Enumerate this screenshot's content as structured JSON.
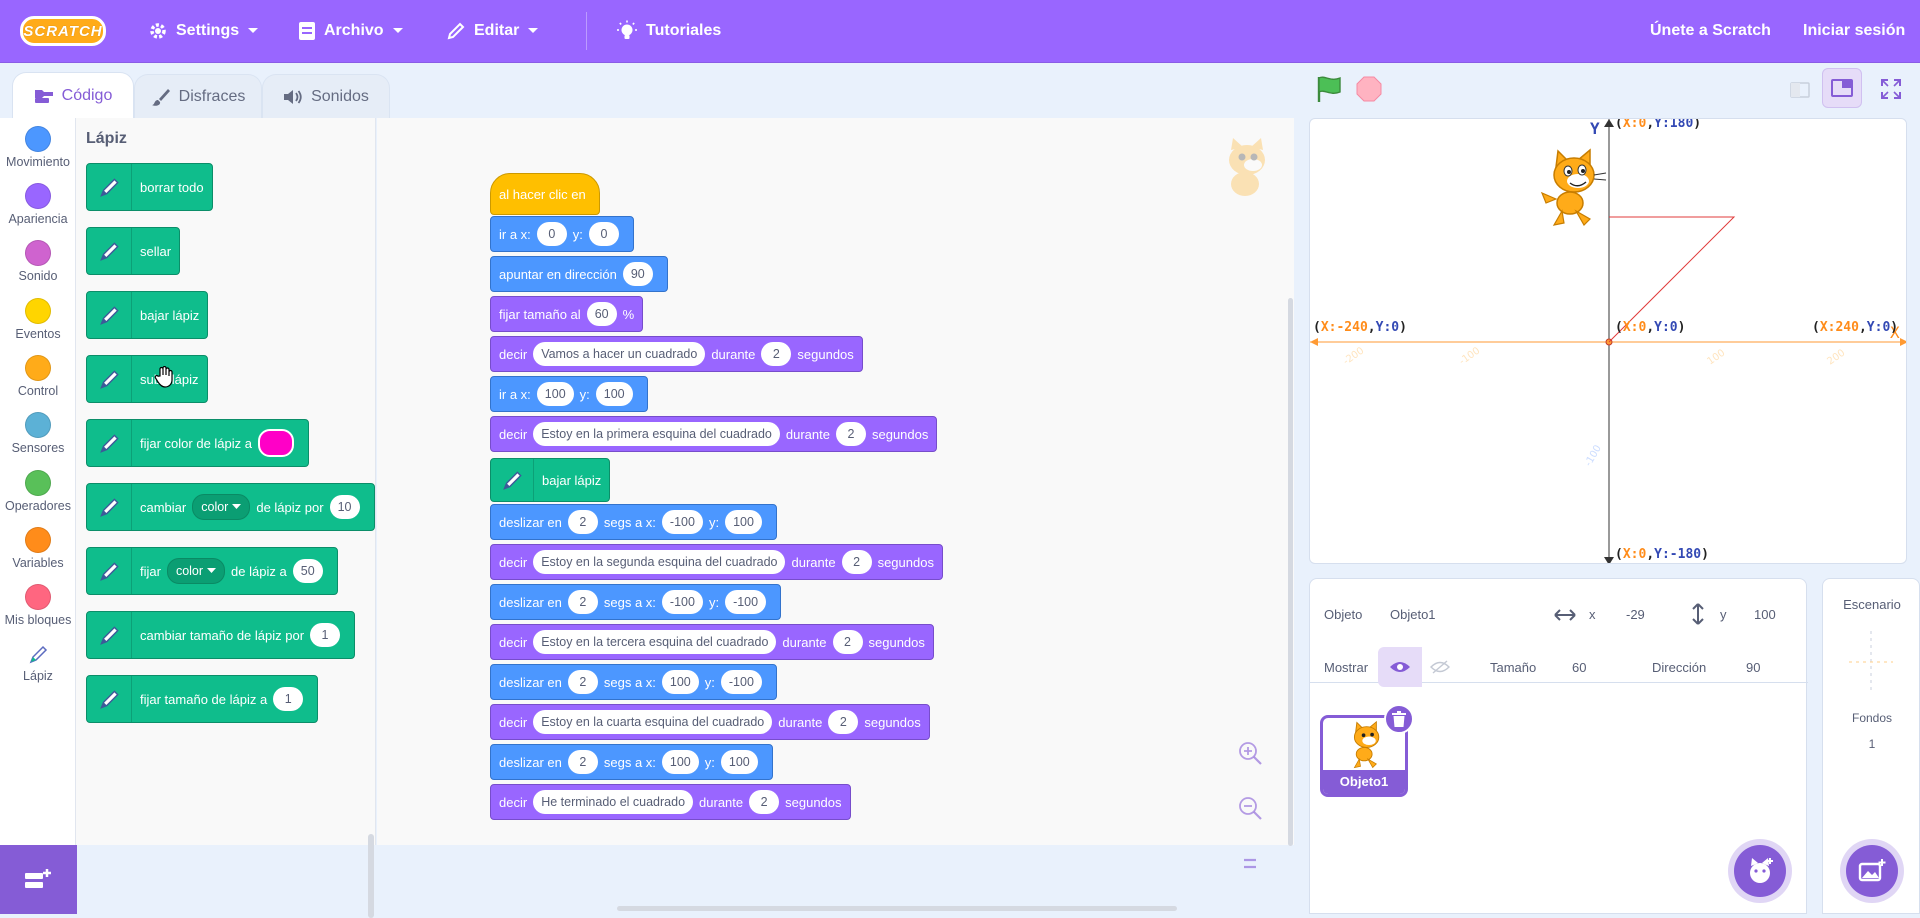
{
  "menubar": {
    "logo": "SCRATCH",
    "settings": "Settings",
    "file": "Archivo",
    "edit": "Editar",
    "tutorials": "Tutoriales",
    "join": "Únete a Scratch",
    "signin": "Iniciar sesión"
  },
  "tabs": {
    "code": "Código",
    "costumes": "Disfraces",
    "sounds": "Sonidos"
  },
  "categories": [
    {
      "label": "Movimiento",
      "color": "#4c97ff"
    },
    {
      "label": "Apariencia",
      "color": "#9966ff"
    },
    {
      "label": "Sonido",
      "color": "#cf63cf"
    },
    {
      "label": "Eventos",
      "color": "#ffd500"
    },
    {
      "label": "Control",
      "color": "#ffab19"
    },
    {
      "label": "Sensores",
      "color": "#5cb1d6"
    },
    {
      "label": "Operadores",
      "color": "#59c059"
    },
    {
      "label": "Variables",
      "color": "#ff8c1a"
    },
    {
      "label": "Mis bloques",
      "color": "#ff6680"
    },
    {
      "label": "Lápiz",
      "color": "#0fbd8c"
    }
  ],
  "palette": {
    "title": "Lápiz",
    "blocks": {
      "erase_all": "borrar todo",
      "stamp": "sellar",
      "pen_down": "bajar lápiz",
      "pen_up": "subir lápiz",
      "set_color_pre": "fijar color de lápiz a",
      "change_pre": "cambiar",
      "change_drop": "color",
      "change_mid": "de lápiz por",
      "change_val": "10",
      "set_pre": "fijar",
      "set_drop": "color",
      "set_mid": "de lápiz a",
      "set_val": "50",
      "change_size_pre": "cambiar tamaño de lápiz por",
      "change_size_val": "1",
      "set_size_pre": "fijar tamaño de lápiz a",
      "set_size_val": "1"
    }
  },
  "script": {
    "hat": "al hacer clic en",
    "goto1": {
      "pre": "ir a x:",
      "x": "0",
      "mid": "y:",
      "y": "0"
    },
    "point": {
      "pre": "apuntar en dirección",
      "val": "90"
    },
    "size": {
      "pre": "fijar tamaño al",
      "val": "60",
      "post": "%"
    },
    "say1": {
      "pre": "decir",
      "msg": "Vamos a hacer un cuadrado",
      "mid": "durante",
      "secs": "2",
      "post": "segundos"
    },
    "goto2": {
      "pre": "ir a x:",
      "x": "100",
      "mid": "y:",
      "y": "100"
    },
    "say2": {
      "pre": "decir",
      "msg": "Estoy en la primera esquina del cuadrado",
      "mid": "durante",
      "secs": "2",
      "post": "segundos"
    },
    "pendown": "bajar lápiz",
    "glide1": {
      "pre": "deslizar en",
      "secs": "2",
      "mid": "segs a x:",
      "x": "-100",
      "ylab": "y:",
      "y": "100"
    },
    "say3": {
      "pre": "decir",
      "msg": "Estoy en la segunda esquina del cuadrado",
      "mid": "durante",
      "secs": "2",
      "post": "segundos"
    },
    "glide2": {
      "pre": "deslizar en",
      "secs": "2",
      "mid": "segs a x:",
      "x": "-100",
      "ylab": "y:",
      "y": "-100"
    },
    "say4": {
      "pre": "decir",
      "msg": "Estoy en la tercera esquina del cuadrado",
      "mid": "durante",
      "secs": "2",
      "post": "segundos"
    },
    "glide3": {
      "pre": "deslizar en",
      "secs": "2",
      "mid": "segs a x:",
      "x": "100",
      "ylab": "y:",
      "y": "-100"
    },
    "say5": {
      "pre": "decir",
      "msg": "Estoy en la cuarta esquina del cuadrado",
      "mid": "durante",
      "secs": "2",
      "post": "segundos"
    },
    "glide4": {
      "pre": "deslizar en",
      "secs": "2",
      "mid": "segs a x:",
      "x": "100",
      "ylab": "y:",
      "y": "100"
    },
    "say6": {
      "pre": "decir",
      "msg": "He terminado el cuadrado",
      "mid": "durante",
      "secs": "2",
      "post": "segundos"
    }
  },
  "stage": {
    "axis_y": "Y",
    "axis_x": "X",
    "top": {
      "xl": "X:",
      "xv": "0",
      "sep": ",",
      "yl": "Y:",
      "yv": "180"
    },
    "bottom": {
      "xl": "X:",
      "xv": "0",
      "sep": ",",
      "yl": "Y:",
      "yv": "-180"
    },
    "left": {
      "xl": "X:",
      "xv": "-240",
      "sep": ",",
      "yl": "Y:",
      "yv": "0"
    },
    "right": {
      "xl": "X:",
      "xv": "240",
      "sep": ",",
      "yl": "Y:",
      "yv": "0"
    },
    "center": {
      "xl": "X:",
      "xv": "0",
      "sep": ",",
      "yl": "Y:",
      "yv": "0"
    }
  },
  "sprite_info": {
    "sprite_label": "Objeto",
    "sprite_name": "Objeto1",
    "x_label": "x",
    "x_value": "-29",
    "y_label": "y",
    "y_value": "100",
    "show_label": "Mostrar",
    "size_label": "Tamaño",
    "size_value": "60",
    "direction_label": "Dirección",
    "direction_value": "90"
  },
  "sprite_list": [
    {
      "name": "Objeto1"
    }
  ],
  "backdrop": {
    "title": "Escenario",
    "backdrops_label": "Fondos",
    "backdrops_count": "1"
  }
}
